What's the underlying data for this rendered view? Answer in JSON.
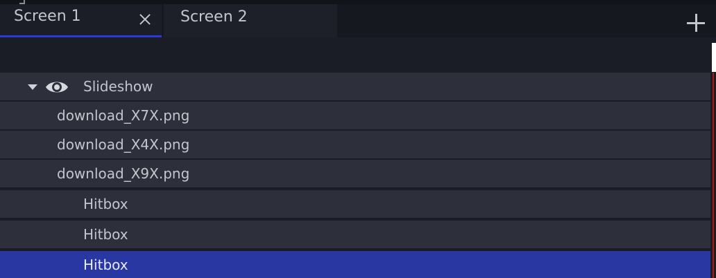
{
  "tabs": [
    {
      "label": "Screen 1",
      "active": true
    },
    {
      "label": "Screen 2",
      "active": false
    }
  ],
  "icons": {
    "close": "close-icon",
    "add": "plus-icon",
    "expand": "caret-down-icon",
    "visibility": "eye-icon"
  },
  "layers": [
    {
      "label": "Slideshow",
      "level": 0,
      "expanded": true,
      "visible": true,
      "selected": false
    },
    {
      "label": "download_X7X.png",
      "level": 1,
      "selected": false
    },
    {
      "label": "download_X4X.png",
      "level": 1,
      "selected": false
    },
    {
      "label": "download_X9X.png",
      "level": 1,
      "selected": false
    },
    {
      "label": "Hitbox",
      "level": 2,
      "selected": false
    },
    {
      "label": "Hitbox",
      "level": 2,
      "selected": false
    },
    {
      "label": "Hitbox",
      "level": 2,
      "selected": true
    }
  ],
  "colors": {
    "active_tab_underline": "#2a3bd6",
    "selected_row": "#2937a3",
    "row_background": "#2d303b",
    "accent_red": "#b01818"
  }
}
